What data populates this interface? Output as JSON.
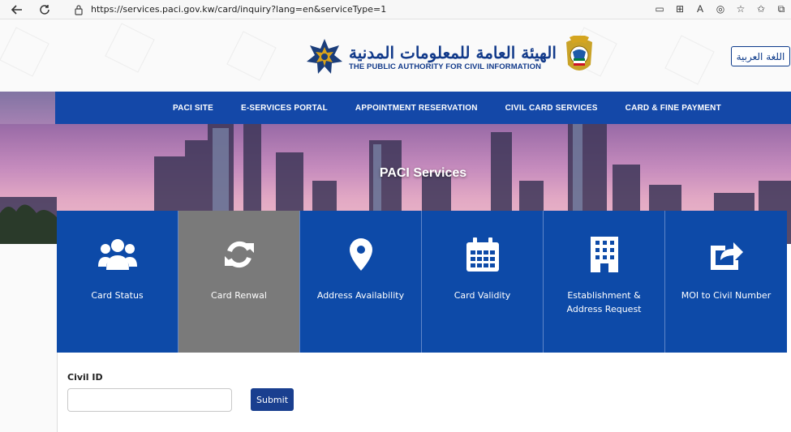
{
  "browser": {
    "url": "https://services.paci.gov.kw/card/inquiry?lang=en&serviceType=1"
  },
  "header": {
    "logo_arabic": "الهيئة العامة للمعلومات المدنية",
    "logo_english": "THE PUBLIC AUTHORITY FOR CIVIL INFORMATION",
    "language_button": "اللغة العربية"
  },
  "nav": {
    "items": [
      {
        "label": "PACI SITE"
      },
      {
        "label": "E-SERVICES PORTAL"
      },
      {
        "label": "APPOINTMENT RESERVATION"
      },
      {
        "label": "CIVIL CARD SERVICES"
      },
      {
        "label": "CARD & FINE PAYMENT"
      }
    ]
  },
  "hero": {
    "title": "PACI Services"
  },
  "services": [
    {
      "label": "Card Status",
      "icon": "users-icon",
      "active": false
    },
    {
      "label": "Card Renwal",
      "icon": "refresh-icon",
      "active": true
    },
    {
      "label": "Address Availability",
      "icon": "map-pin-icon",
      "active": false
    },
    {
      "label": "Card Validity",
      "icon": "calendar-icon",
      "active": false
    },
    {
      "label": "Establishment & Address Request",
      "icon": "building-icon",
      "active": false
    },
    {
      "label": "MOI to Civil Number",
      "icon": "share-icon",
      "active": false
    }
  ],
  "form": {
    "civil_id_label": "Civil ID",
    "civil_id_value": "",
    "submit_label": "Submit"
  },
  "colors": {
    "nav_blue": "#1448a8",
    "tile_blue": "#0d4aa8",
    "tile_active": "#7a7a7a",
    "submit_blue": "#1a3f8f"
  }
}
